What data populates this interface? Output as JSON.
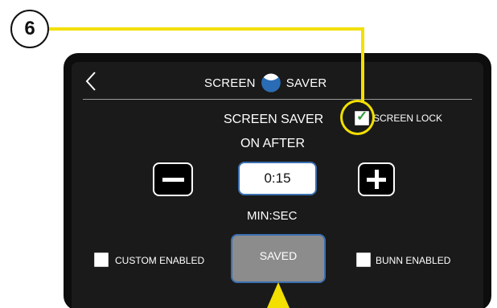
{
  "callout": {
    "number": "6"
  },
  "header": {
    "title_left": "SCREEN",
    "title_right": "SAVER"
  },
  "screen_saver": {
    "title": "SCREEN SAVER",
    "subtitle": "ON AFTER",
    "time_value": "0:15",
    "unit_label": "MIN:SEC"
  },
  "screen_lock": {
    "label": "SCREEN LOCK",
    "checked": true
  },
  "custom_enabled": {
    "label": "CUSTOM ENABLED",
    "checked": false
  },
  "bunn_enabled": {
    "label": "BUNN ENABLED",
    "checked": false
  },
  "saved_button": {
    "label": "SAVED"
  },
  "colors": {
    "callout_yellow": "#f3df00",
    "field_border_blue": "#3a6fb0",
    "logo_blue": "#2a6cb5",
    "check_green": "#2f9b3a",
    "saved_button_gray": "#8c8c8c"
  },
  "icons": [
    "back-chevron-icon",
    "brand-logo-icon",
    "minus-icon",
    "plus-icon",
    "checkmark-icon",
    "pointer-arrow-icon"
  ]
}
